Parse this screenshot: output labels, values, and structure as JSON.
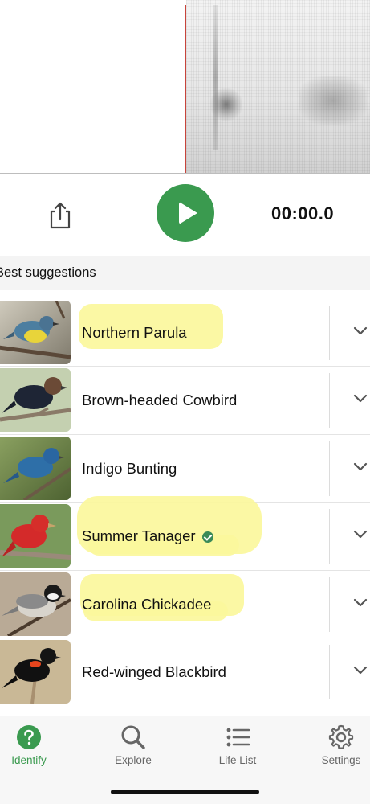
{
  "controls": {
    "share_icon": "share-icon",
    "play_icon": "play-icon",
    "timer": "00:00.0",
    "accent_color": "#3a9a4f"
  },
  "section": {
    "title": "Best suggestions"
  },
  "suggestions": [
    {
      "name": "Northern Parula",
      "verified": false,
      "highlighted": true
    },
    {
      "name": "Brown-headed Cowbird",
      "verified": false,
      "highlighted": false
    },
    {
      "name": "Indigo Bunting",
      "verified": false,
      "highlighted": false
    },
    {
      "name": "Summer Tanager",
      "verified": true,
      "highlighted": true
    },
    {
      "name": "Carolina Chickadee",
      "verified": false,
      "highlighted": true
    },
    {
      "name": "Red-winged Blackbird",
      "verified": false,
      "highlighted": false
    }
  ],
  "tabs": [
    {
      "label": "Identify",
      "icon": "question-circle-icon",
      "active": true
    },
    {
      "label": "Explore",
      "icon": "magnifier-icon",
      "active": false
    },
    {
      "label": "Life List",
      "icon": "list-icon",
      "active": false
    },
    {
      "label": "Settings",
      "icon": "gear-icon",
      "active": false
    }
  ]
}
